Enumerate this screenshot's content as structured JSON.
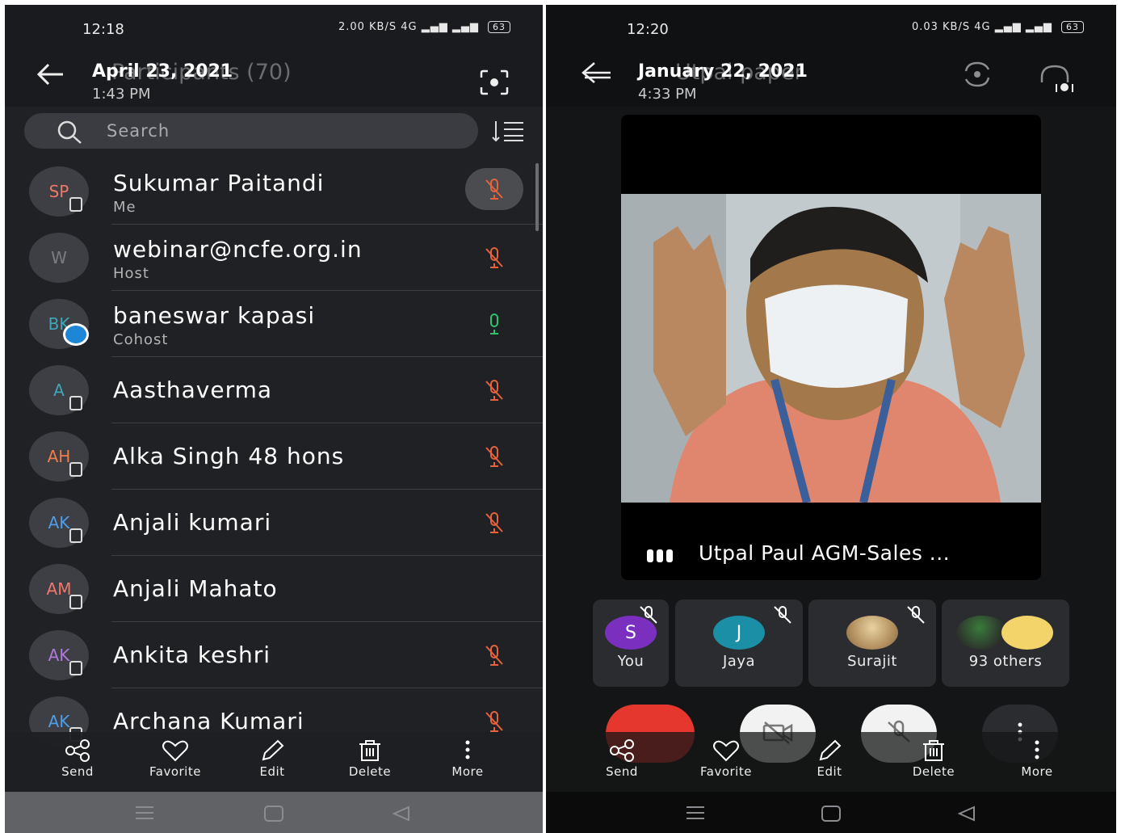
{
  "left": {
    "status_time": "12:18",
    "status_speed": "2.00 KB/S",
    "battery": "63",
    "title_ghost": "Participants (70)",
    "date": "April 23, 2021",
    "time": "1:43 PM",
    "search_placeholder": "Search",
    "participants": [
      {
        "initials": "SP",
        "initials_color": "#f0786a",
        "name": "Sukumar Paitandi",
        "role": "Me",
        "mic": "muted",
        "mic_bg": true,
        "device": true
      },
      {
        "initials": "W",
        "initials_color": "#7b7d80",
        "name": "webinar@ncfe.org.in",
        "role": "Host",
        "mic": "muted",
        "device": false
      },
      {
        "initials": "BK",
        "initials_color": "#3ea7b8",
        "name": "baneswar kapasi",
        "role": "Cohost",
        "mic": "active",
        "device": false,
        "badge": true
      },
      {
        "initials": "A",
        "initials_color": "#3ea7b8",
        "name": "Aasthaverma",
        "role": "",
        "mic": "muted",
        "device": true
      },
      {
        "initials": "AH",
        "initials_color": "#f07c4a",
        "name": "Alka Singh 48 hons",
        "role": "",
        "mic": "muted",
        "device": true
      },
      {
        "initials": "AK",
        "initials_color": "#4d9ee8",
        "name": "Anjali kumari",
        "role": "",
        "mic": "muted",
        "device": true
      },
      {
        "initials": "AM",
        "initials_color": "#f0786a",
        "name": "Anjali Mahato",
        "role": "",
        "mic": "none",
        "device": true
      },
      {
        "initials": "AK",
        "initials_color": "#b07adb",
        "name": "Ankita keshri",
        "role": "",
        "mic": "muted",
        "device": true
      },
      {
        "initials": "AK",
        "initials_color": "#4d9ee8",
        "name": "Archana Kumari",
        "role": "",
        "mic": "muted",
        "device": true
      }
    ],
    "actions": {
      "send": "Send",
      "favorite": "Favorite",
      "edit": "Edit",
      "delete": "Delete",
      "more": "More"
    }
  },
  "right": {
    "status_time": "12:20",
    "status_speed": "0.03 KB/S",
    "battery": "63",
    "title_ghost": "Utpal paper",
    "date": "January 22, 2021",
    "time": "4:33 PM",
    "speaker_caption": "Utpal Paul AGM-Sales ...",
    "tiles": [
      {
        "label": "You",
        "initial": "S",
        "color": "#7b2fbf"
      },
      {
        "label": "Jaya",
        "initial": "J",
        "color": "#1a8fa5"
      },
      {
        "label": "Surajit",
        "initial": "",
        "color": "#c8a878"
      },
      {
        "label": "93 others",
        "initial": "",
        "color": "#d9a43a"
      }
    ],
    "actions": {
      "send": "Send",
      "favorite": "Favorite",
      "edit": "Edit",
      "delete": "Delete",
      "more": "More"
    }
  },
  "colors": {
    "muted_mic": "#e8623c",
    "active_mic": "#2fc46a",
    "end_call": "#e5372e"
  }
}
